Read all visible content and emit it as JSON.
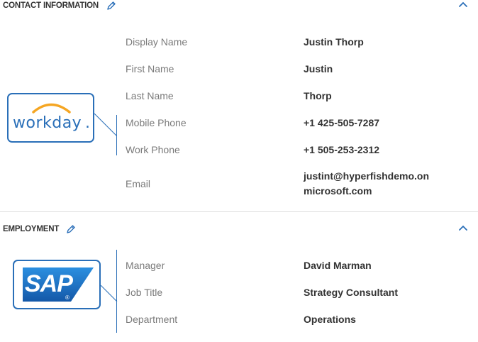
{
  "contact": {
    "title": "CONTACT INFORMATION",
    "edit_icon": "pencil-icon",
    "collapse_icon": "chevron-up-icon",
    "logo": {
      "text": "workday",
      "suffix": ".",
      "icon": "workday-logo",
      "color": "#2a6fb8",
      "arc_color": "#f5a623"
    },
    "fields": [
      {
        "label": "Display Name",
        "value": "Justin Thorp"
      },
      {
        "label": "First Name",
        "value": "Justin"
      },
      {
        "label": "Last Name",
        "value": "Thorp"
      },
      {
        "label": "Mobile Phone",
        "value": "+1 425-505-7287"
      },
      {
        "label": "Work Phone",
        "value": "+1 505-253-2312"
      },
      {
        "label": "Email",
        "value_line1": "justint@hyperfishdemo.on",
        "value_line2": "microsoft.com"
      }
    ]
  },
  "employment": {
    "title": "EMPLOYMENT",
    "edit_icon": "pencil-icon",
    "collapse_icon": "chevron-up-icon",
    "logo": {
      "text": "SAP",
      "trademark": "®",
      "icon": "sap-logo",
      "color": "#1a73c7"
    },
    "fields": [
      {
        "label": "Manager",
        "value": "David Marman"
      },
      {
        "label": "Job Title",
        "value": "Strategy Consultant"
      },
      {
        "label": "Department",
        "value": "Operations"
      }
    ]
  },
  "colors": {
    "accent": "#2a6fb8",
    "label": "#7a7a7a",
    "value": "#333333",
    "divider": "#dddddd"
  }
}
